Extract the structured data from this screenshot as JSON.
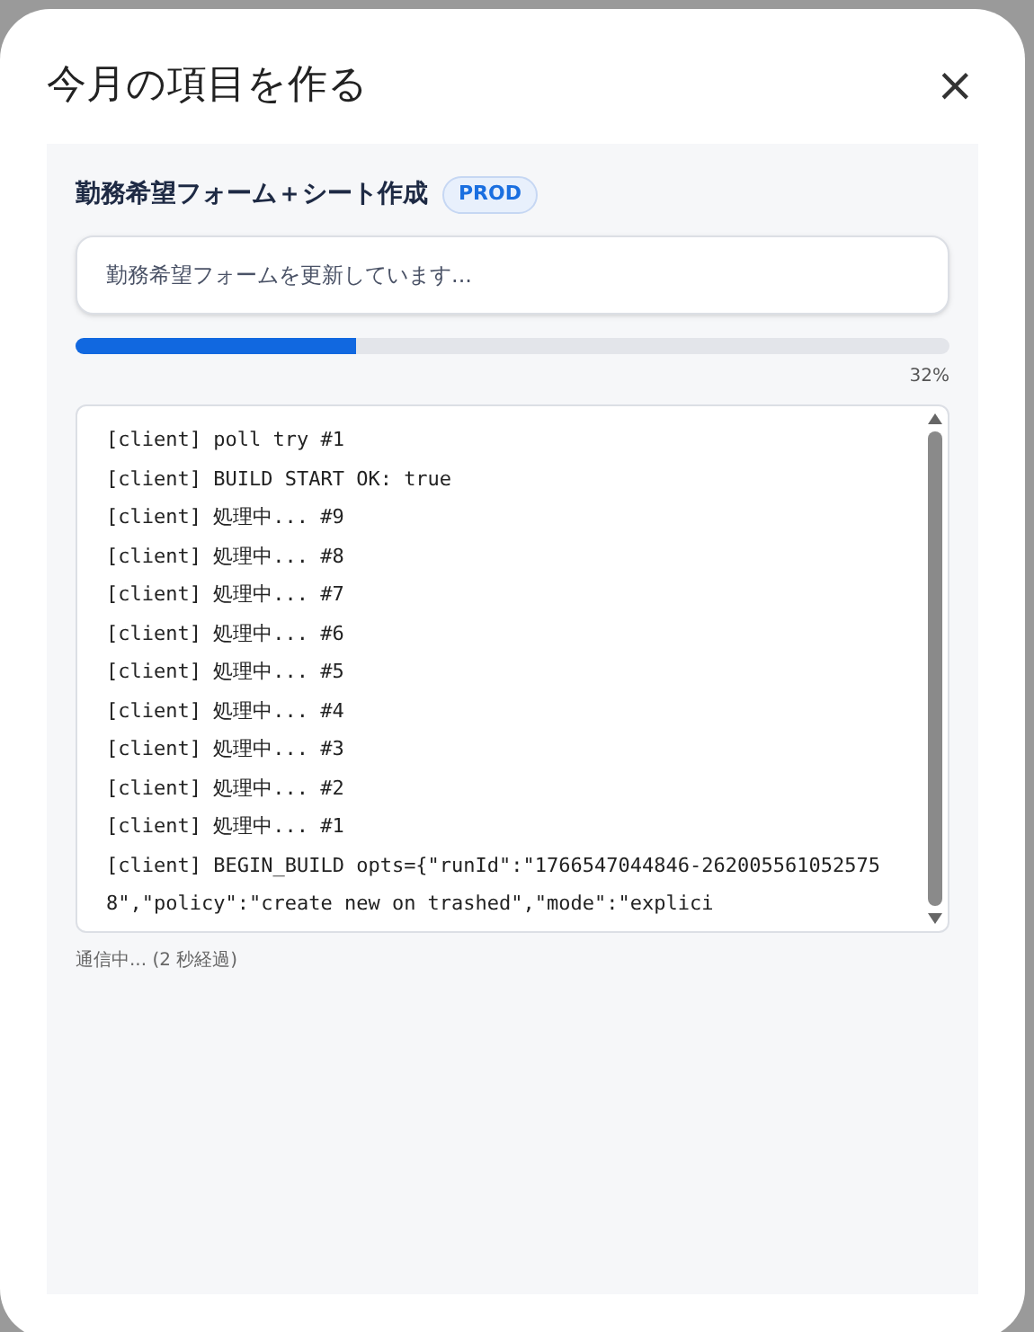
{
  "dialog": {
    "title": "今月の項目を作る",
    "close": "×"
  },
  "job": {
    "title": "勤務希望フォーム＋シート作成",
    "badge": "PROD",
    "status": "勤務希望フォームを更新しています...",
    "level": 0.32,
    "percent": "32%"
  },
  "log": [
    "[client] poll try #1",
    "[client] BUILD START OK: true",
    "[client] 処理中... #9",
    "[client] 処理中... #8",
    "[client] 処理中... #7",
    "[client] 処理中... #6",
    "[client] 処理中... #5",
    "[client] 処理中... #4",
    "[client] 処理中... #3",
    "[client] 処理中... #2",
    "[client] 処理中... #1",
    "[client] BEGIN_BUILD opts={\"runId\":\"1766547044846-2620055610525758\",\"policy\":\"create new on trashed\",\"mode\":\"explici"
  ],
  "footer": "通信中... (2 秒経過)"
}
